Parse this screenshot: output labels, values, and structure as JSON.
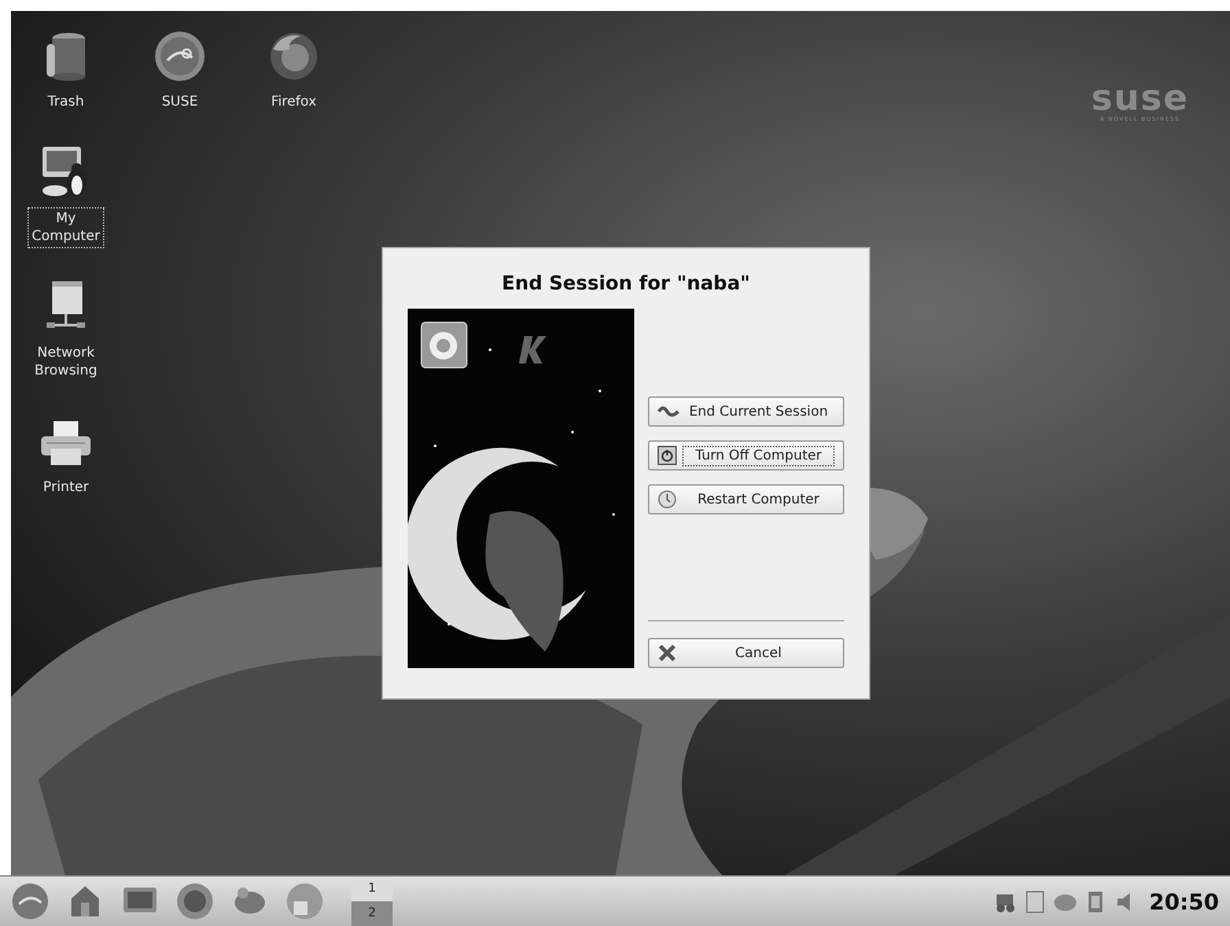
{
  "desktop_icons": [
    {
      "label": "Trash",
      "kind": "trash",
      "selected": false
    },
    {
      "label": "SUSE",
      "kind": "suse",
      "selected": false
    },
    {
      "label": "Firefox",
      "kind": "firefox",
      "selected": false
    },
    {
      "label": "My Computer",
      "kind": "computer",
      "selected": true
    },
    {
      "label": "Network Browsing",
      "kind": "network",
      "selected": false
    },
    {
      "label": "Printer",
      "kind": "printer",
      "selected": false
    }
  ],
  "wallpaper_logo": {
    "wordmark": "suse",
    "tagline": "A NOVELL BUSINESS"
  },
  "dialog": {
    "title": "End Session for \"naba\"",
    "actions": [
      {
        "label": "End Current Session",
        "kind": "logout",
        "focused": false
      },
      {
        "label": "Turn Off Computer",
        "kind": "power",
        "focused": true
      },
      {
        "label": "Restart Computer",
        "kind": "restart",
        "focused": false
      }
    ],
    "cancel": {
      "label": "Cancel",
      "kind": "cancel",
      "focused": false
    }
  },
  "taskbar": {
    "pager": [
      {
        "label": "1",
        "selected": true
      },
      {
        "label": "2",
        "selected": false
      }
    ],
    "clock": "20:50"
  }
}
